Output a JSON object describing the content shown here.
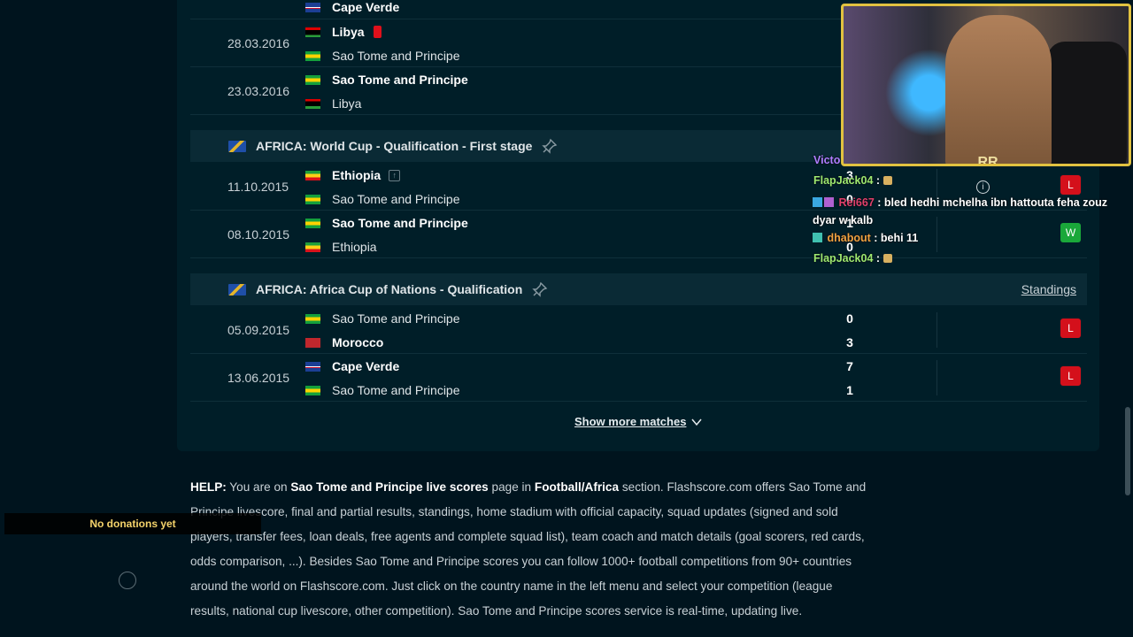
{
  "matches": [
    {
      "date": "",
      "home": {
        "name": "Cape Verde",
        "flag": "cv",
        "winner": true
      }
    },
    {
      "date": "28.03.2016",
      "home": {
        "name": "Libya",
        "flag": "ly",
        "winner": true,
        "red_card": true
      },
      "away": {
        "name": "Sao Tome and Principe",
        "flag": "stp",
        "winner": false
      }
    },
    {
      "date": "23.03.2016",
      "home": {
        "name": "Sao Tome and Principe",
        "flag": "stp",
        "winner": true
      },
      "away": {
        "name": "Libya",
        "flag": "ly",
        "winner": false
      }
    }
  ],
  "league1": {
    "name": "AFRICA: World Cup - Qualification - First stage"
  },
  "league1_matches": [
    {
      "date": "11.10.2015",
      "home": "Ethiopia",
      "away": "Sao Tome and Principe",
      "result": "L",
      "home_score": "3",
      "away_score": "0"
    },
    {
      "date": "08.10.2015",
      "home": "Sao Tome and Principe",
      "away": "Ethiopia",
      "result": "W",
      "home_score": "1",
      "away_score": "0"
    }
  ],
  "league2": {
    "name": "AFRICA: Africa Cup of Nations - Qualification",
    "standings": "Standings"
  },
  "league2_matches": [
    {
      "date": "05.09.2015",
      "home": "Sao Tome and Principe",
      "away": "Morocco",
      "home_score": "0",
      "away_score": "3",
      "result": "L"
    },
    {
      "date": "13.06.2015",
      "home": "Cape Verde",
      "away": "Sao Tome and Principe",
      "home_score": "7",
      "away_score": "1",
      "result": "L"
    }
  ],
  "show_more": "Show more matches",
  "help": {
    "label": "HELP:",
    "t1": " You are on ",
    "b1": "Sao Tome and Principe live scores",
    "t2": " page in ",
    "b2": "Football/Africa",
    "t3": " section. Flashscore.com offers Sao Tome and Principe livescore, final and partial results, standings, home stadium with official capacity, squad updates (signed and sold players, transfer fees, loan deals, free agents and complete squad list), team coach and match details (goal scorers, red cards, odds comparison, ...). Besides Sao Tome and Principe scores you can follow 1000+ football competitions from 90+ countries around the world on Flashscore.com. Just click on the country name in the left menu and select your competition (league results, national cup livescore, other competition). Sao Tome and Principe scores service is real-time, updating live."
  },
  "overlay": {
    "donations": "No donations yet",
    "chat": [
      {
        "user": "Victo",
        "msg": ""
      },
      {
        "user": "FlapJack04",
        "msg": " :"
      },
      {
        "user": "Rei667",
        "msg": " : bled hedhi mchelha ibn hattouta feha zouz dyar w kalb"
      },
      {
        "user": "dhabout",
        "msg": " : behi 11"
      },
      {
        "user": "FlapJack04",
        "msg": " :"
      }
    ],
    "cam_logo": "RR"
  },
  "colors": {
    "loss": "#d4101b",
    "win": "#1aa83a",
    "background": "#00141e",
    "panel": "#001e28"
  }
}
